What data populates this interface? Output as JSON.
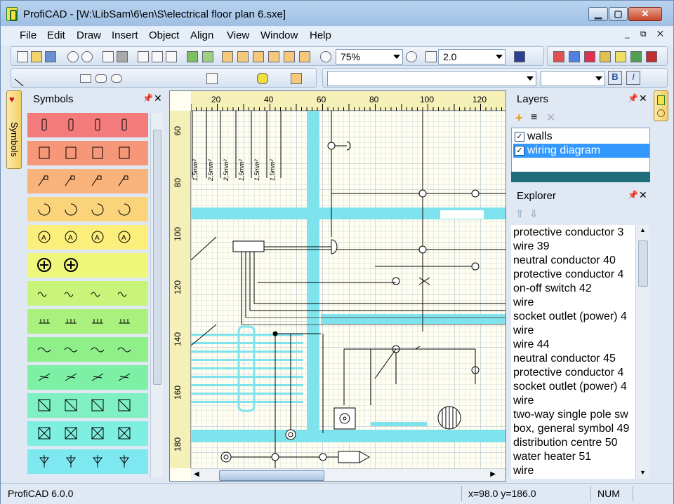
{
  "window": {
    "title": "ProfiCAD - [W:\\LibSam\\6\\en\\S\\electrical floor plan 6.sxe]",
    "min_label": "▁",
    "max_label": "▢",
    "close_label": "✕"
  },
  "menu": [
    "File",
    "Edit",
    "Draw",
    "Insert",
    "Object",
    "Align",
    "View",
    "Window",
    "Help"
  ],
  "mdi_controls": "_ ⧉ ✕",
  "toolbar": {
    "zoom_value": "75%",
    "line_width_value": "2.0",
    "font_combo_value": "",
    "font_size_value": "",
    "bold_label": "B",
    "italic_label": "I"
  },
  "symbols_panel": {
    "title": "Symbols",
    "tab_label": "Symbols",
    "row_colors": [
      "#f47b7b",
      "#f7977a",
      "#f9b27a",
      "#fbd37a",
      "#fbee7a",
      "#eef77a",
      "#c9f47a",
      "#a9f07d",
      "#8ff08a",
      "#7ef0a5",
      "#7ef0c3",
      "#7eefe0",
      "#7ee8f0"
    ]
  },
  "ruler": {
    "h_labels": [
      "20",
      "40",
      "60",
      "80",
      "100",
      "120"
    ],
    "v_labels": [
      "60",
      "80",
      "100",
      "120",
      "140",
      "160",
      "180"
    ]
  },
  "cable_labels": [
    "1,5mm²",
    "2,5mm²",
    "2,5mm²",
    "1,5mm²",
    "1,5mm²",
    "1,5mm²"
  ],
  "layers_panel": {
    "title": "Layers",
    "items": [
      {
        "label": "walls",
        "checked": "✓"
      },
      {
        "label": "wiring diagram",
        "checked": "✓"
      }
    ]
  },
  "explorer_panel": {
    "title": "Explorer",
    "items": [
      "protective conductor 3",
      "wire 39",
      "neutral conductor 40",
      "protective conductor 4",
      "on-off switch 42",
      "wire",
      "socket outlet (power) 4",
      "wire",
      "wire 44",
      "neutral conductor 45",
      "protective conductor 4",
      "socket outlet (power) 4",
      "wire",
      "two-way single pole sw",
      "box, general symbol 49",
      "distribution centre 50",
      "water heater 51",
      "wire"
    ]
  },
  "status": {
    "text": "ProfiCAD 6.0.0",
    "coords": "x=98.0  y=186.0",
    "num": "NUM"
  }
}
